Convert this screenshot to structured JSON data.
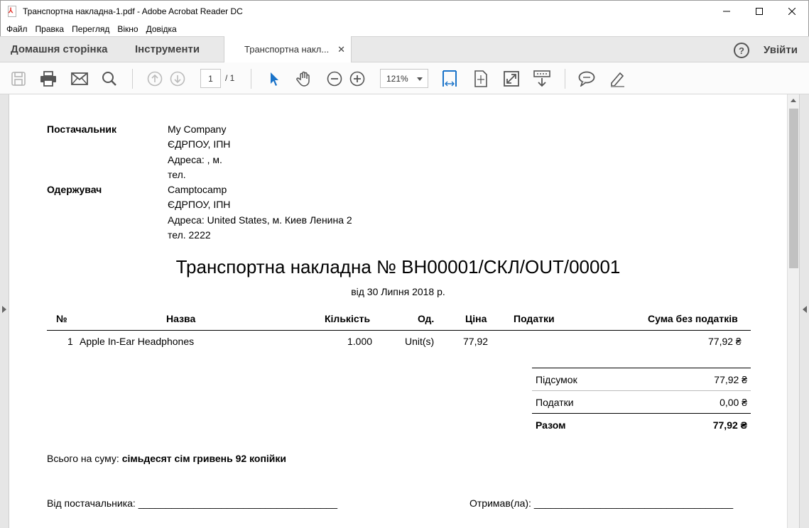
{
  "window": {
    "title": "Транспортна накладна-1.pdf - Adobe Acrobat Reader DC",
    "minimize_icon": "minimize-icon",
    "maximize_icon": "maximize-icon",
    "close_icon": "close-icon"
  },
  "menu": {
    "items": [
      "Файл",
      "Правка",
      "Перегляд",
      "Вікно",
      "Довідка"
    ]
  },
  "tabs": {
    "home": "Домашня сторінка",
    "tools": "Інструменти",
    "document": "Транспортна накл...",
    "close_glyph": "✕",
    "help_glyph": "?",
    "signin": "Увійти"
  },
  "toolbar": {
    "page_current": "1",
    "page_total": "/ 1",
    "zoom": "121%"
  },
  "invoice": {
    "supplier_label": "Постачальник",
    "supplier_lines": [
      "My Company",
      "ЄДРПОУ, ІПН",
      "Адреса: , м.",
      "тел."
    ],
    "receiver_label": "Одержувач",
    "receiver_lines": [
      "Camptocamp",
      "ЄДРПОУ, ІПН",
      "Адреса: United States, м. Киев Ленина 2",
      "тел. 2222"
    ],
    "title": "Транспортна накладна № BH00001/СКЛ/OUT/00001",
    "date": "від 30 Липня 2018 р.",
    "columns": {
      "no": "№",
      "name": "Назва",
      "qty": "Кількість",
      "unit": "Од.",
      "price": "Ціна",
      "taxes": "Податки",
      "amount": "Сума без податків"
    },
    "rows": [
      {
        "no": "1",
        "name": "Apple In-Ear Headphones",
        "qty": "1.000",
        "unit": "Unit(s)",
        "price": "77,92",
        "taxes": "",
        "amount": "77,92 ₴"
      }
    ],
    "summary": {
      "subtotal_label": "Підсумок",
      "subtotal_value": "77,92 ₴",
      "taxes_label": "Податки",
      "taxes_value": "0,00 ₴",
      "total_label": "Разом",
      "total_value": "77,92 ₴"
    },
    "total_words_label": "Всього на суму:",
    "total_words_value": "сімьдесят сім гривень 92 копійки",
    "from_supplier": "Від постачальника: ____________________________________",
    "received": "Отримав(ла): ____________________________________"
  }
}
